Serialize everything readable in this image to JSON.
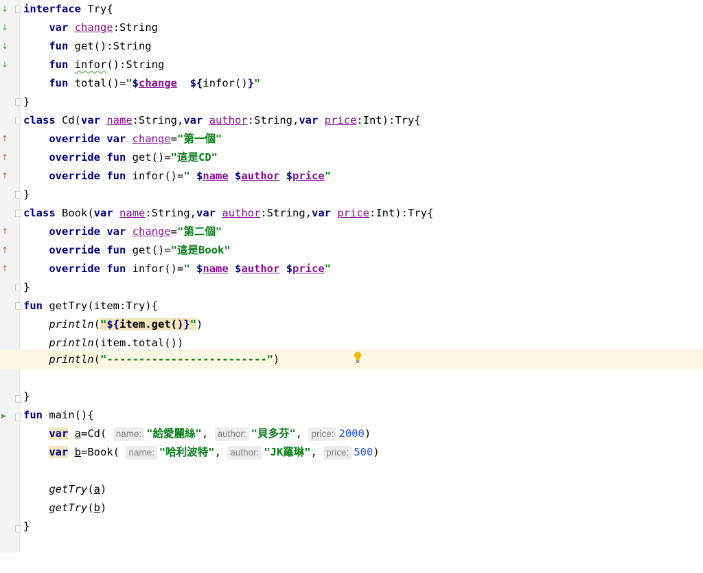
{
  "editor": {
    "lines": {
      "l1": {
        "kw": "interface",
        "name": " Try{"
      },
      "l2": {
        "kw": "var",
        "prop": "change",
        "rest": ":String"
      },
      "l3": {
        "kw": "fun",
        "rest": " get():String"
      },
      "l4": {
        "kw": "fun",
        "squig": "infor",
        "rest": "():String"
      },
      "l5": {
        "kw": "fun",
        "rest1": " total()=",
        "s1": "\"",
        "tm1": "$",
        "prop": "change",
        "s2": "  ",
        "tm2": "${",
        "mid": "infor()",
        "tm3": "}",
        "s3": "\""
      },
      "l6": {
        "text": "}"
      },
      "l7": {
        "kw1": "class",
        "t1": " Cd(",
        "kw2": "var",
        "p1": "name",
        "t2": ":String,",
        "kw3": "var",
        "p2": "author",
        "t3": ":String,",
        "kw4": "var",
        "p3": "price",
        "t4": ":Int):Try{"
      },
      "l8": {
        "kw1": "override",
        "kw2": "var",
        "prop": "change",
        "eq": "=",
        "str": "\"第一個\""
      },
      "l9": {
        "kw1": "override",
        "kw2": "fun",
        "rest": " get()=",
        "str": "\"這是CD\""
      },
      "l10": {
        "kw1": "override",
        "kw2": "fun",
        "rest": " infor()=",
        "s1": "\" ",
        "d1": "$",
        "p1": "name",
        "sp1": " ",
        "d2": "$",
        "p2": "author",
        "sp2": " ",
        "d3": "$",
        "p3": "price",
        "s2": "\""
      },
      "l11": {
        "text": "}"
      },
      "l12": {
        "kw1": "class",
        "t1": " Book(",
        "kw2": "var",
        "p1": "name",
        "t2": ":String,",
        "kw3": "var",
        "p2": "author",
        "t3": ":String,",
        "kw4": "var",
        "p3": "price",
        "t4": ":Int):Try{"
      },
      "l13": {
        "kw1": "override",
        "kw2": "var",
        "prop": "change",
        "eq": "=",
        "str": "\"第二個\""
      },
      "l14": {
        "kw1": "override",
        "kw2": "fun",
        "rest": " get()=",
        "str": "\"這是Book\""
      },
      "l15": {
        "kw1": "override",
        "kw2": "fun",
        "rest": " infor()=",
        "s1": "\" ",
        "d1": "$",
        "p1": "name",
        "sp1": " ",
        "d2": "$",
        "p2": "author",
        "sp2": " ",
        "d3": "$",
        "p3": "price",
        "s2": "\""
      },
      "l16": {
        "text": "}"
      },
      "l17": {
        "kw": "fun",
        "rest": " getTry(item:Try){"
      },
      "l18": {
        "fn": "println",
        "open": "(",
        "s1": "\"",
        "tm1": "${",
        "mid": "item.get()",
        "tm2": "}",
        "s2": "\"",
        "close": ")"
      },
      "l19": {
        "fn": "println",
        "rest": "(item.total())"
      },
      "l20": {
        "fn": "println",
        "open": "(",
        "str": "\"-------------------------\"",
        "close": ")"
      },
      "l22": {
        "text": "}"
      },
      "l23": {
        "kw": "fun",
        "rest": " main(){"
      },
      "l24": {
        "kw": "var",
        "sp": " ",
        "v": "a",
        "t1": "=Cd(",
        "h1": "name:",
        "s1": "\"給愛麗絲\"",
        "c1": ",",
        "h2": "author:",
        "s2": "\"貝多芬\"",
        "c2": ",",
        "h3": "price:",
        "n": "2000",
        "close": ")"
      },
      "l25": {
        "kw": "var",
        "sp": " ",
        "v": "b",
        "t1": "=Book(",
        "h1": "name:",
        "s1": "\"哈利波特\"",
        "c1": ",",
        "h2": "author:",
        "s2": "\"JK羅琳\"",
        "c2": ",",
        "h3": "price:",
        "n": "500",
        "close": ")"
      },
      "l27": {
        "fn": "getTry",
        "open": "(",
        "arg": "a",
        "close": ")"
      },
      "l28": {
        "fn": "getTry",
        "open": "(",
        "arg": "b",
        "close": ")"
      },
      "l29": {
        "text": "}"
      }
    },
    "gutter_icons": {
      "implemented": "implemented-arrow-icon",
      "overrides": "override-arrow-icon",
      "run": "run-triangle-icon",
      "fold": "fold-marker-icon",
      "bulb": "lightbulb-icon"
    },
    "colors": {
      "keyword": "#000080",
      "string": "#067d17",
      "number": "#1750eb",
      "property": "#871094",
      "caret_line": "#fcf8e3"
    }
  }
}
